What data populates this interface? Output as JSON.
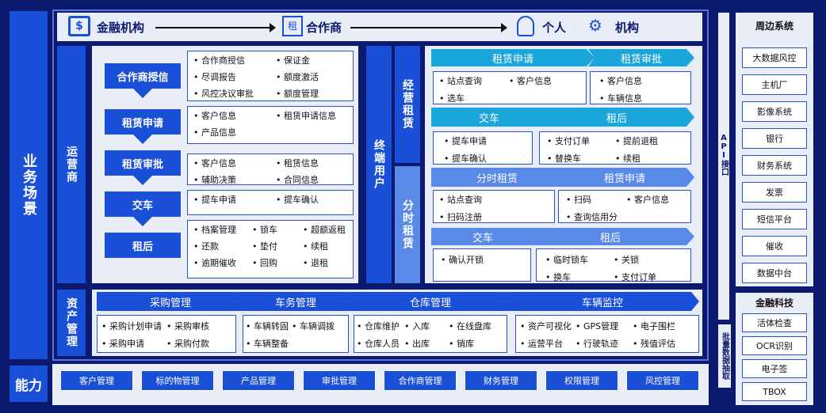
{
  "left_labels": {
    "business": "业务场景",
    "capability": "能力"
  },
  "header": {
    "finance": "金融机构",
    "partner_icon": "租",
    "partner": "合作商",
    "person": "个人",
    "institution": "机构"
  },
  "ops": {
    "label": "运营商",
    "steps": [
      {
        "name": "合作商授信",
        "items": [
          "合作商授信",
          "保证金",
          "尽调报告",
          "额度激活",
          "风控决议审批",
          "额度管理"
        ]
      },
      {
        "name": "租赁申请",
        "items": [
          "客户信息",
          "租赁申请信息",
          "产品信息"
        ]
      },
      {
        "name": "租赁审批",
        "items": [
          "客户信息",
          "租赁信息",
          "辅助决策",
          "合同信息"
        ]
      },
      {
        "name": "交车",
        "items": [
          "提车申请",
          "提车确认"
        ]
      },
      {
        "name": "租后",
        "items": [
          "档案管理",
          "锁车",
          "超额返租",
          "还款",
          "垫付",
          "续租",
          "逾期催收",
          "回购",
          "退租"
        ]
      }
    ]
  },
  "terminal": {
    "label": "终端用户",
    "op_lease": "经营租赁",
    "time_lease": "分时租赁"
  },
  "op_flow": {
    "a": "租赁申请",
    "b": "租赁审批",
    "a_items": [
      "站点查询",
      "客户信息",
      "选车"
    ],
    "b_items": [
      "客户信息",
      "车辆信息"
    ],
    "c": "交车",
    "d": "租后",
    "c_items": [
      "提车申请",
      "提车确认"
    ],
    "d_items": [
      "支付订单",
      "提前退租",
      "替换车",
      "续租"
    ]
  },
  "time_flow": {
    "a": "分时租赁",
    "b": "租赁申请",
    "a_items": [
      "站点查询",
      "扫码注册"
    ],
    "b_items": [
      "扫码",
      "客户信息",
      "查询信用分"
    ],
    "c": "交车",
    "d": "租后",
    "c_items": [
      "确认开锁"
    ],
    "d_items": [
      "临时锁车",
      "关锁",
      "换车",
      "支付订单"
    ]
  },
  "asset": {
    "label": "资产管理",
    "heads": [
      "采购管理",
      "车务管理",
      "仓库管理",
      "车辆监控"
    ],
    "procure": [
      "采购计划申请",
      "采购审核",
      "采购申请",
      "采购付款"
    ],
    "vehicle": [
      "车辆转固",
      "车辆调拨",
      "车辆整备"
    ],
    "warehouse": [
      "仓库维护",
      "入库",
      "在线盘库",
      "仓库人员",
      "出库",
      "销库"
    ],
    "monitor": [
      "资产可视化",
      "GPS管理",
      "电子围栏",
      "运营平台",
      "行驶轨迹",
      "残值评估"
    ]
  },
  "capabilities": [
    "客户管理",
    "标的物管理",
    "产品管理",
    "审批管理",
    "合作商管理",
    "财务管理",
    "权限管理",
    "风控管理"
  ],
  "api_label": "API接口",
  "batch_label": "批量数据抽取",
  "peripheral": {
    "title": "周边系统",
    "items": [
      "大数据风控",
      "主机厂",
      "影像系统",
      "银行",
      "财务系统",
      "发票",
      "短信平台",
      "催收",
      "数据中台"
    ]
  },
  "fintech": {
    "title": "金融科技",
    "items": [
      "活体检查",
      "OCR识别",
      "电子签",
      "TBOX"
    ]
  },
  "colors": {
    "navy": "#0b1a6e",
    "blue": "#1a4fd8",
    "cyan": "#1aa6d8",
    "light": "#e9edf8"
  }
}
